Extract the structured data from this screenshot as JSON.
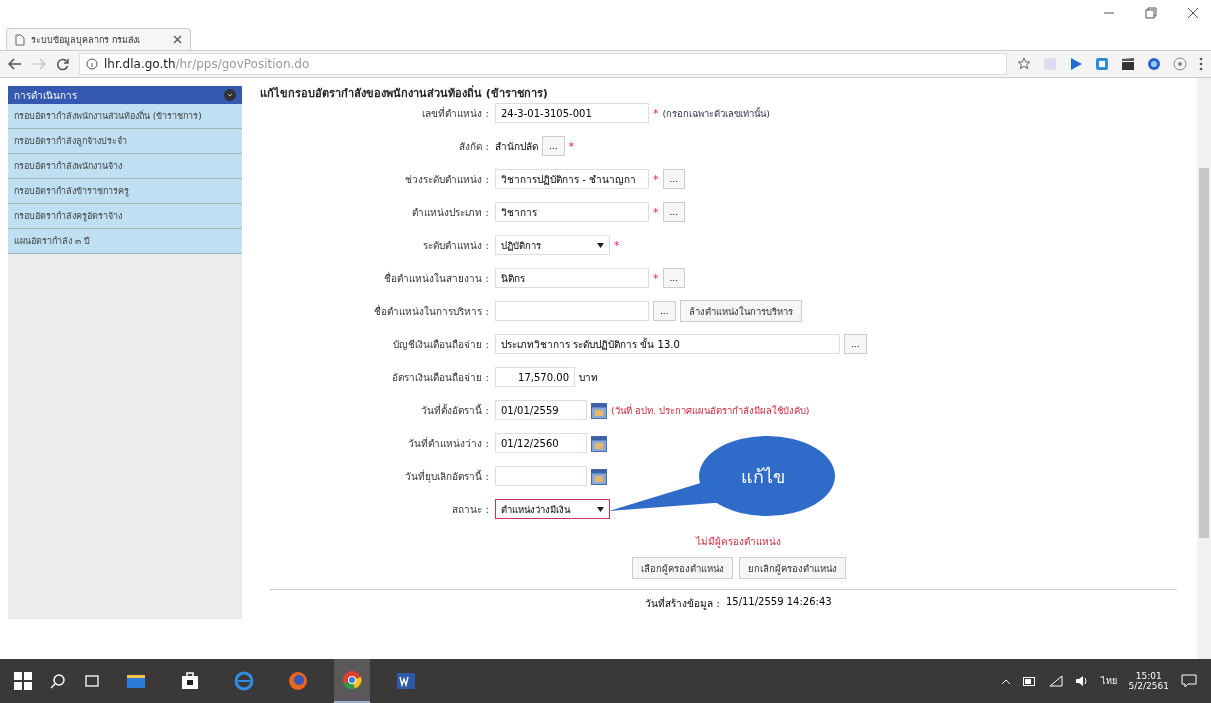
{
  "browser": {
    "tab_title": "ระบบข้อมูลบุคลากร กรมส่งเ",
    "url_host": "lhr.dla.go.th",
    "url_path": "/hr/pps/govPosition.do"
  },
  "sidebar": {
    "title": "การดำเนินการ",
    "items": [
      {
        "label": "กรอบอัตรากำลังพนักงานส่วนท้องถิ่น (ข้าราชการ)"
      },
      {
        "label": "กรอบอัตรากำลังลูกจ้างประจำ"
      },
      {
        "label": "กรอบอัตรากำลังพนักงานจ้าง"
      },
      {
        "label": "กรอบอัตรากำลังข้าราชการครู"
      },
      {
        "label": "กรอบอัตรากำลังครูอัตราจ้าง"
      },
      {
        "label": "แผนอัตรากำลัง ๓ ปี"
      }
    ]
  },
  "form": {
    "title": "แก้ไขกรอบอัตรากำลังของพนักงานส่วนท้องถิ่น (ข้าราชการ)",
    "fields": [
      {
        "label": "เลขที่ตำแหน่ง :",
        "kind": "text",
        "value": "24-3-01-3105-001",
        "required_mark": "*",
        "note": {
          "text": "(กรอกเฉพาะตัวเลขเท่านั้น)",
          "warning": false
        }
      },
      {
        "label": "สังกัด :",
        "kind": "static",
        "value": "สำนักปลัด",
        "picker_label": "...",
        "required_mark": "*"
      },
      {
        "label": "ช่วงระดับตำแหน่ง :",
        "kind": "text",
        "value": "วิชาการปฏิบัติการ - ชำนาญกา",
        "required_mark": "*",
        "picker_label": "..."
      },
      {
        "label": "ตำแหน่งประเภท :",
        "kind": "text",
        "value": "วิชาการ",
        "required_mark": "*",
        "picker_label": "..."
      },
      {
        "label": "ระดับตำแหน่ง :",
        "kind": "select",
        "value": "ปฏิบัติการ",
        "required_mark": "*"
      },
      {
        "label": "ชื่อตำแหน่งในสายงาน :",
        "kind": "text",
        "value": "นิติกร",
        "required_mark": "*",
        "picker_label": "..."
      },
      {
        "label": "ชื่อตำแหน่งในการบริหาร :",
        "kind": "text",
        "picker_label": "...",
        "extra_button": "ล้างตำแหน่งในการบริหาร"
      },
      {
        "label": "บัญชีเงินเดือนถือจ่าย :",
        "kind": "wide",
        "value": "ประเภทวิชาการ ระดับปฏิบัติการ ขั้น 13.0",
        "picker_label": "..."
      },
      {
        "label": "อัตราเงินเดือนถือจ่าย :",
        "kind": "money",
        "value": "17,570.00",
        "unit": "บาท"
      },
      {
        "label": "วันที่ตั้งอัตรานี้ :",
        "kind": "date",
        "value": "01/01/2559",
        "note": {
          "text": "(วันที่ อปท. ประกาศแผนอัตรากำลังมีผลใช้บังคับ)",
          "warning": true
        }
      },
      {
        "label": "วันที่ตำแหน่งว่าง :",
        "kind": "date",
        "value": "01/12/2560"
      },
      {
        "label": "วันที่ยุบเลิกอัตรานี้ :",
        "kind": "date"
      },
      {
        "label": "สถานะ :",
        "kind": "select",
        "value": "ตำแหน่งว่างมีเงิน",
        "highlighted": true,
        "callout": "แก้ไข"
      }
    ],
    "holder_status": "ไม่มีผู้ครองตำแหน่ง",
    "buttons": [
      "เลือกผู้ครองตำแหน่ง",
      "ยกเลิกผู้ครองตำแหน่ง"
    ],
    "created_label": "วันที่สร้างข้อมูล :",
    "created_value": "15/11/2559 14:26:43"
  },
  "taskbar": {
    "apps": [
      {
        "kind": "explorer",
        "selected": false
      },
      {
        "kind": "store",
        "selected": false
      },
      {
        "kind": "ie",
        "selected": false
      },
      {
        "kind": "firefox",
        "selected": false
      },
      {
        "kind": "chrome",
        "selected": true
      },
      {
        "kind": "word",
        "selected": false
      }
    ],
    "language": "ไทย",
    "time": "15:01",
    "date": "5/2/2561"
  }
}
